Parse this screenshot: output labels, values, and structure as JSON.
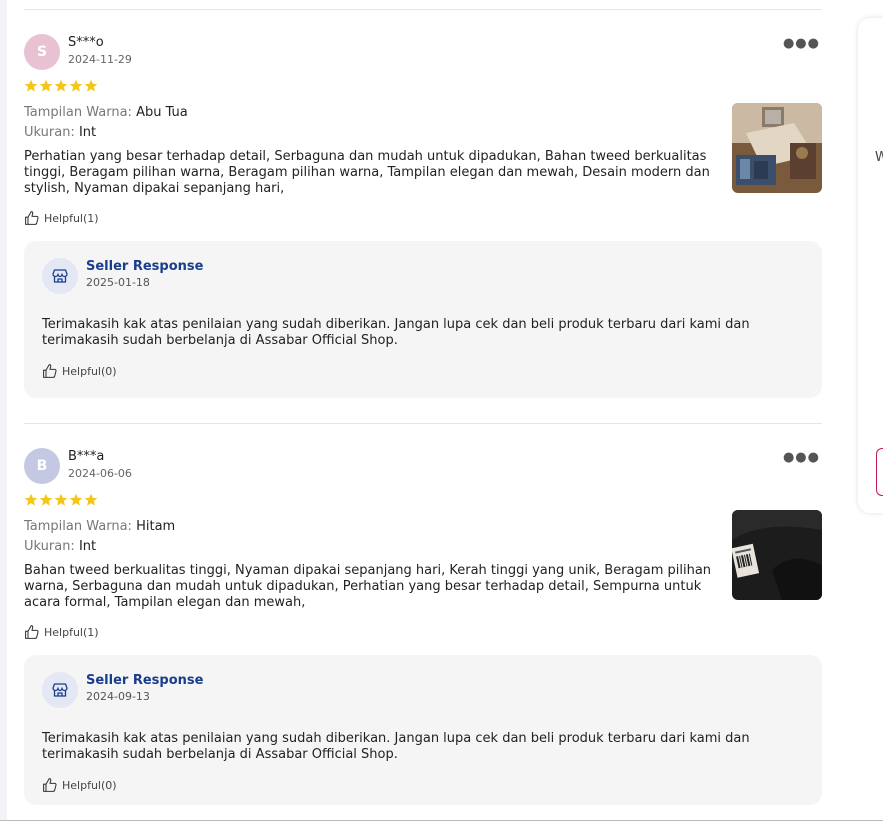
{
  "reviews": [
    {
      "avatar_letter": "S",
      "avatar_color": "#e8c2d2",
      "name": "S***o",
      "date": "2024-11-29",
      "rating": 5,
      "color_label": "Tampilan Warna:",
      "color_value": "Abu Tua",
      "size_label": "Ukuran:",
      "size_value": "Int",
      "text": "Perhatian yang besar terhadap detail, Serbaguna dan mudah untuk dipadukan, Bahan tweed berkualitas tinggi, Beragam pilihan warna, Beragam pilihan warna, Tampilan elegan dan mewah, Desain modern dan stylish, Nyaman dipakai sepanjang hari,",
      "helpful": "Helpful(1)",
      "response": {
        "title": "Seller Response",
        "date": "2025-01-18",
        "text": "Terimakasih kak atas penilaian yang sudah diberikan. Jangan lupa cek dan beli produk terbaru dari kami dan terimakasih sudah berbelanja di Assabar Official Shop.",
        "helpful": "Helpful(0)"
      }
    },
    {
      "avatar_letter": "B",
      "avatar_color": "#c5c8e3",
      "name": "B***a",
      "date": "2024-06-06",
      "rating": 5,
      "color_label": "Tampilan Warna:",
      "color_value": "Hitam",
      "size_label": "Ukuran:",
      "size_value": "Int",
      "text": "Bahan tweed berkualitas tinggi, Nyaman dipakai sepanjang hari, Kerah tinggi yang unik, Beragam pilihan warna, Serbaguna dan mudah untuk dipadukan, Perhatian yang besar terhadap detail, Sempurna untuk acara formal, Tampilan elegan dan mewah,",
      "helpful": "Helpful(1)",
      "response": {
        "title": "Seller Response",
        "date": "2024-09-13",
        "text": "Terimakasih kak atas penilaian yang sudah diberikan. Jangan lupa cek dan beli produk terbaru dari kami dan terimakasih sudah berbelanja di Assabar Official Shop.",
        "helpful": "Helpful(0)"
      }
    }
  ],
  "side": {
    "letter": "W"
  },
  "colors": {
    "star": "#f5c518",
    "seller_title": "#1a3d8c",
    "accent": "#c2185b"
  },
  "icons": [
    "more-options-icon",
    "star-icon",
    "thumbs-up-icon",
    "store-icon"
  ]
}
